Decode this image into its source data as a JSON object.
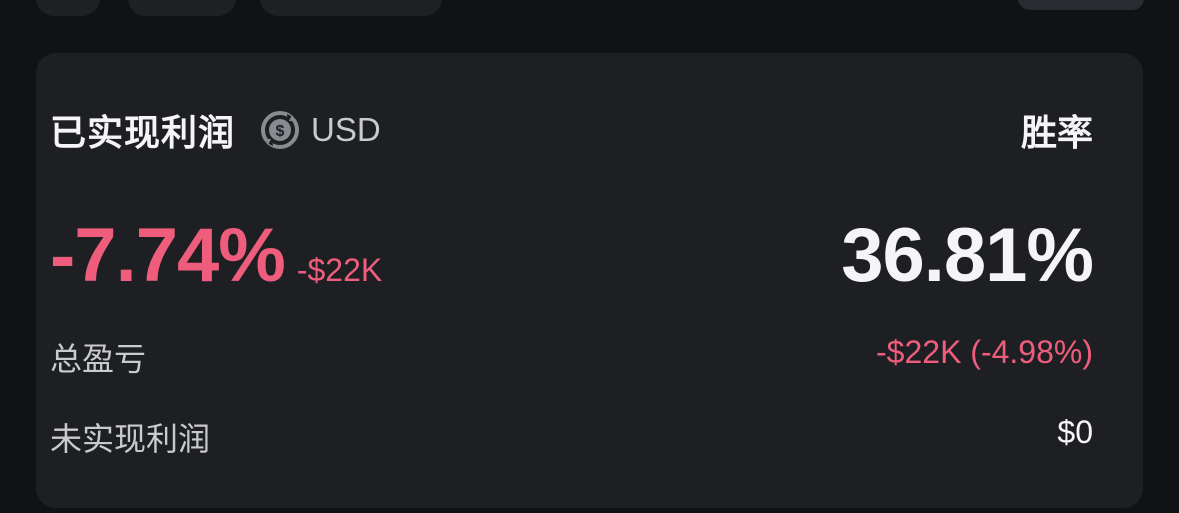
{
  "colors": {
    "background": "#111214",
    "card": "#1e1f23",
    "negative": "#ef5d7d",
    "text_primary": "#f5f5f7",
    "text_secondary": "#c9cacf"
  },
  "card": {
    "title": "已实现利润",
    "currency_icon": "currency-convert-icon",
    "currency_code": "USD",
    "realized_pct": "-7.74%",
    "realized_amount": "-$22K",
    "winrate_label": "胜率",
    "winrate_value": "36.81%",
    "rows": [
      {
        "label": "总盈亏",
        "value": "-$22K (-4.98%)"
      },
      {
        "label": "未实现利润",
        "value": "$0"
      }
    ]
  }
}
